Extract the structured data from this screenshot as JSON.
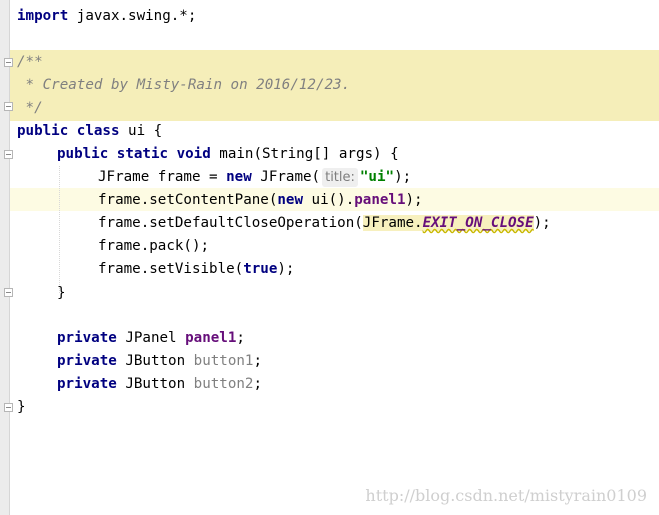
{
  "lines": [
    {
      "kw1": "import",
      "rest": " javax.swing.*;"
    },
    {
      "c1": "/**"
    },
    {
      "c2": " * Created by Misty-Rain on 2016/12/23."
    },
    {
      "c3": " */"
    },
    {
      "kw1": "public",
      "kw2": "class",
      "rest": " ui {"
    },
    {
      "kw1": "public",
      "kw2": "static",
      "kw3": "void",
      "rest": " main(String[] args) {"
    },
    {
      "t1": "JFrame frame = ",
      "kw": "new",
      "t2": " JFrame(",
      "hint": "title:",
      "str": "\"ui\"",
      "t3": ");"
    },
    {
      "t1": "frame.setContentPane(",
      "kw": "new",
      "t2": " ui().",
      "field": "panel1",
      "t3": ");"
    },
    {
      "t1": "frame.setDefaultCloseOperation(",
      "cls": "JFrame.",
      "const": "EXIT_ON_CLOSE",
      "t3": ");"
    },
    {
      "t1": "frame.pack();"
    },
    {
      "t1": "frame.setVisible(",
      "kw": "true",
      "t3": ");"
    },
    {
      "t1": "}"
    },
    {
      "kw": "private",
      "t1": " JPanel ",
      "field": "panel1",
      "t3": ";"
    },
    {
      "kw": "private",
      "t1": " JButton ",
      "ufield": "button1",
      "t3": ";"
    },
    {
      "kw": "private",
      "t1": " JButton ",
      "ufield": "button2",
      "t3": ";"
    },
    {
      "t1": "}"
    }
  ],
  "watermark": "http://blog.csdn.net/mistyrain0109"
}
